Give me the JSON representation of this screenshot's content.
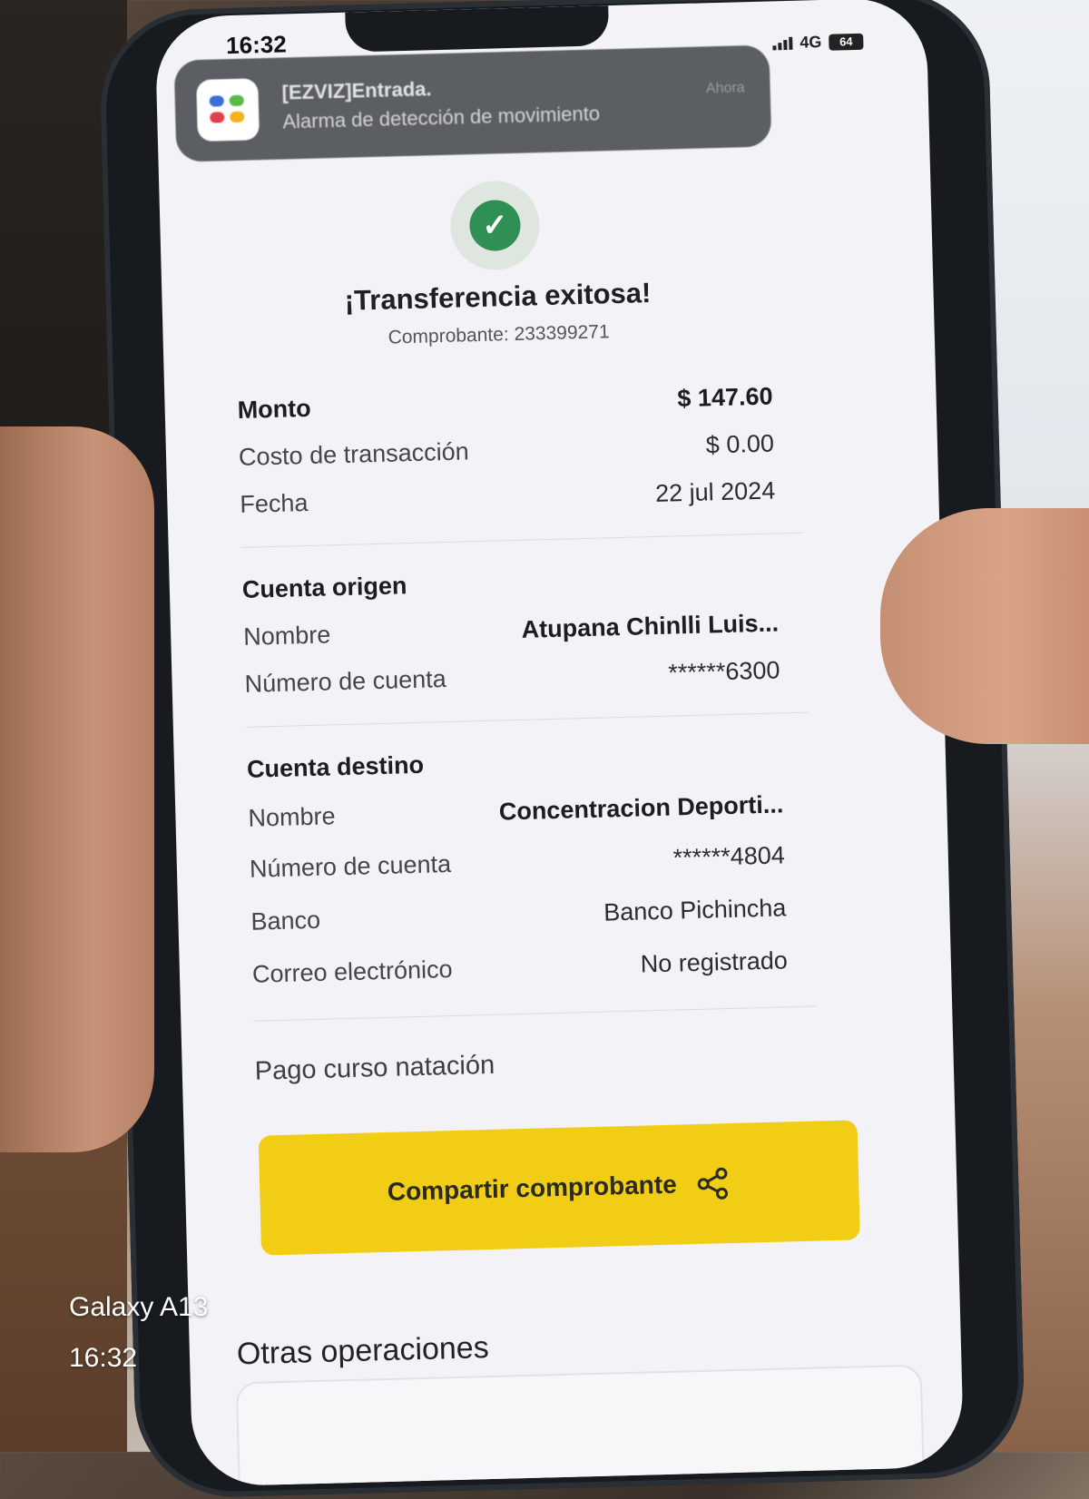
{
  "status_bar": {
    "time": "16:32",
    "network": "4G",
    "battery": "64"
  },
  "notification": {
    "title": "[EZVIZ]Entrada.",
    "body": "Alarma de detección de movimiento",
    "time": "Ahora",
    "app_icon": "ezviz-app-icon"
  },
  "receipt": {
    "title": "¡Transferencia exitosa!",
    "subtitle": "Comprobante: 233399271",
    "summary": [
      {
        "label": "Monto",
        "value": "$ 147.60"
      },
      {
        "label": "Costo de transacción",
        "value": "$ 0.00"
      },
      {
        "label": "Fecha",
        "value": "22 jul 2024"
      }
    ],
    "origin": {
      "heading": "Cuenta origen",
      "rows": [
        {
          "label": "Nombre",
          "value": "Atupana  Chinlli Luis..."
        },
        {
          "label": "Número de cuenta",
          "value": "******6300"
        }
      ]
    },
    "destination": {
      "heading": "Cuenta destino",
      "rows": [
        {
          "label": "Nombre",
          "value": "Concentracion Deporti..."
        },
        {
          "label": "Número de cuenta",
          "value": "******4804"
        },
        {
          "label": "Banco",
          "value": "Banco Pichincha"
        },
        {
          "label": "Correo electrónico",
          "value": "No registrado"
        }
      ]
    },
    "description": "Pago curso natación",
    "share_button": "Compartir comprobante",
    "other_operations": "Otras operaciones"
  },
  "colors": {
    "accent": "#f2cd16",
    "success": "#2f8f55"
  },
  "camera_watermark": {
    "model": "Galaxy A13",
    "time": "16:32"
  }
}
